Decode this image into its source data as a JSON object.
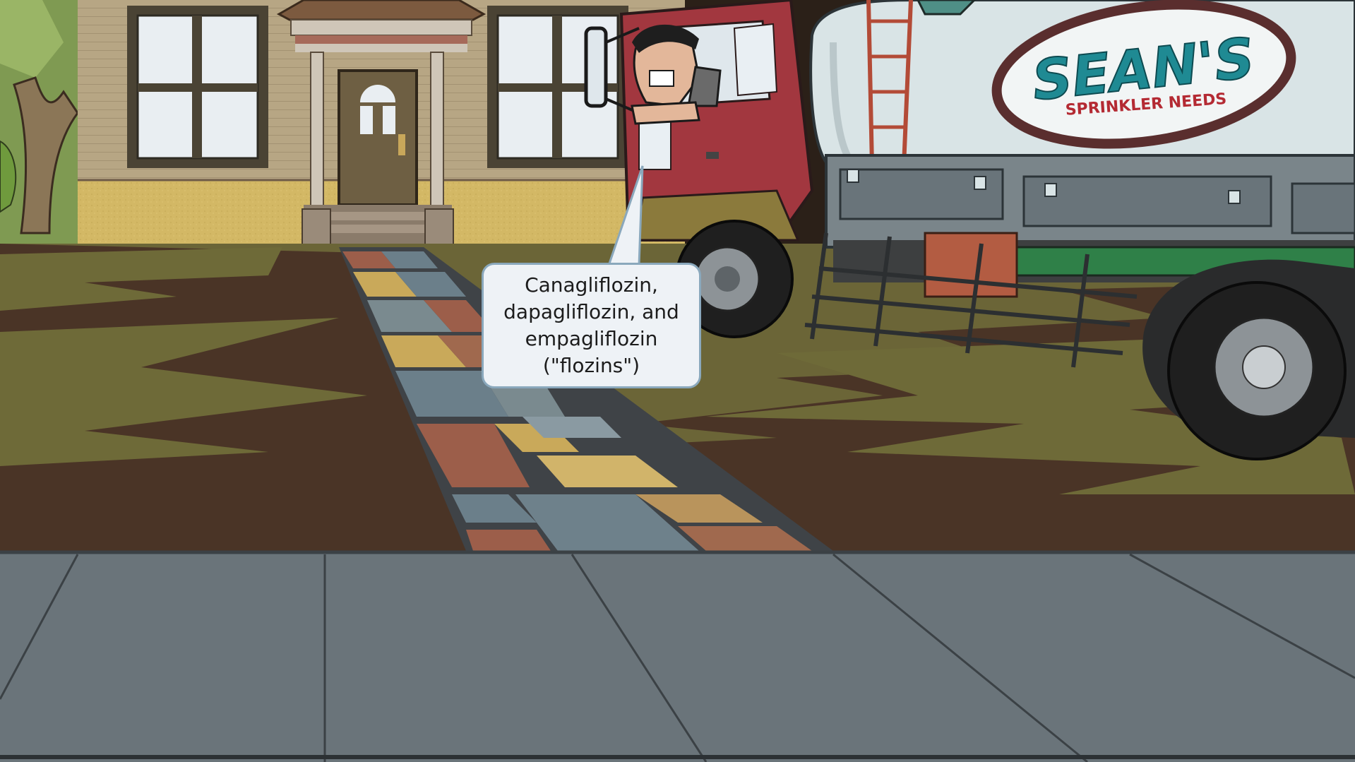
{
  "scene": {
    "speech_bubble": {
      "lines": [
        "Canagliflozin,",
        "dapagliflozin, and",
        "empagliflozin",
        "(\"flozins\")"
      ]
    },
    "truck_logo": {
      "name": "SEAN'S",
      "tagline": "SPRINKLER NEEDS"
    },
    "colors": {
      "sky_house_wall": "#b5a585",
      "house_base": "#d2b766",
      "lawn_dark": "#4a3426",
      "lawn_grass": "#6e6a38",
      "sidewalk": "#6a747a",
      "truck_cab": "#a2373f",
      "truck_tank": "#d9e4e6",
      "logo_teal": "#1f8a93",
      "logo_red": "#b42a33",
      "speech_border": "#8aa8bc"
    }
  }
}
